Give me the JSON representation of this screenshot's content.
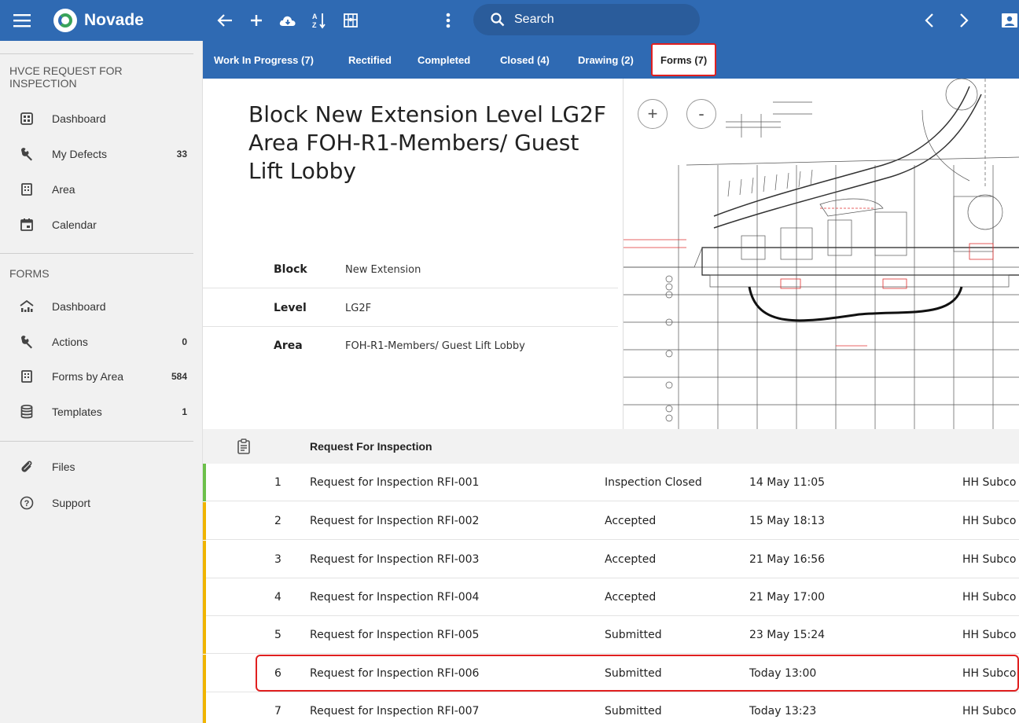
{
  "app": {
    "name": "Novade",
    "brand_color": "#2f6ab3",
    "search_placeholder": "Search",
    "icons": [
      "menu-icon",
      "back-arrow-icon",
      "add-icon",
      "cloud-download-icon",
      "sort-az-icon",
      "map-icon",
      "more-vert-icon",
      "search-icon",
      "chevron-left-icon",
      "chevron-right-icon",
      "user-icon"
    ]
  },
  "tabs": [
    {
      "label": "Work In Progress (7)",
      "active": false
    },
    {
      "label": "Rectified",
      "active": false
    },
    {
      "label": "Completed",
      "active": false
    },
    {
      "label": "Closed (4)",
      "active": false
    },
    {
      "label": "Drawing (2)",
      "active": false
    },
    {
      "label": "Forms (7)",
      "active": true
    }
  ],
  "sidebar": {
    "section1_title": "HVCE REQUEST FOR INSPECTION",
    "items1": [
      {
        "label": "Dashboard",
        "count": "",
        "icon": "dashboard-grid-icon"
      },
      {
        "label": "My Defects",
        "count": "33",
        "icon": "wrench-icon"
      },
      {
        "label": "Area",
        "count": "",
        "icon": "building-icon"
      },
      {
        "label": "Calendar",
        "count": "",
        "icon": "calendar-icon"
      }
    ],
    "section2_title": "FORMS",
    "items2": [
      {
        "label": "Dashboard",
        "count": "",
        "icon": "chart-dashboard-icon"
      },
      {
        "label": "Actions",
        "count": "0",
        "icon": "wrench-icon"
      },
      {
        "label": "Forms by Area",
        "count": "584",
        "icon": "building-icon"
      },
      {
        "label": "Templates",
        "count": "1",
        "icon": "database-icon"
      }
    ],
    "items3": [
      {
        "label": "Files",
        "icon": "paperclip-icon"
      },
      {
        "label": "Support",
        "icon": "help-circle-icon"
      }
    ]
  },
  "location": {
    "title": "Block New Extension Level LG2F Area FOH-R1-Members/ Guest Lift Lobby",
    "fields": [
      {
        "key": "Block",
        "value": "New Extension"
      },
      {
        "key": "Level",
        "value": "LG2F"
      },
      {
        "key": "Area",
        "value": "FOH-R1-Members/ Guest Lift Lobby"
      }
    ]
  },
  "drawing": {
    "zoom_in": "+",
    "zoom_out": "-"
  },
  "forms_list": {
    "header": "Request For Inspection",
    "rows": [
      {
        "num": "1",
        "name": "Request for Inspection RFI-001",
        "status": "Inspection Closed",
        "date": "14 May 11:05",
        "party": "HH Subco",
        "color": "#6cc04a"
      },
      {
        "num": "2",
        "name": "Request for Inspection RFI-002",
        "status": "Accepted",
        "date": "15 May 18:13",
        "party": "HH Subco",
        "color": "#f0b400"
      },
      {
        "num": "3",
        "name": "Request for Inspection RFI-003",
        "status": "Accepted",
        "date": "21 May 16:56",
        "party": "HH Subco",
        "color": "#f0b400"
      },
      {
        "num": "4",
        "name": "Request for Inspection RFI-004",
        "status": "Accepted",
        "date": "21 May 17:00",
        "party": "HH Subco",
        "color": "#f0b400"
      },
      {
        "num": "5",
        "name": "Request for Inspection RFI-005",
        "status": "Submitted",
        "date": "23 May 15:24",
        "party": "HH Subco",
        "color": "#f0b400"
      },
      {
        "num": "6",
        "name": "Request for Inspection RFI-006",
        "status": "Submitted",
        "date": "Today 13:00",
        "party": "HH Subco",
        "color": "#f0b400"
      },
      {
        "num": "7",
        "name": "Request for Inspection RFI-007",
        "status": "Submitted",
        "date": "Today 13:23",
        "party": "HH Subco",
        "color": "#f0b400"
      }
    ]
  },
  "highlight_color": "#e02020"
}
